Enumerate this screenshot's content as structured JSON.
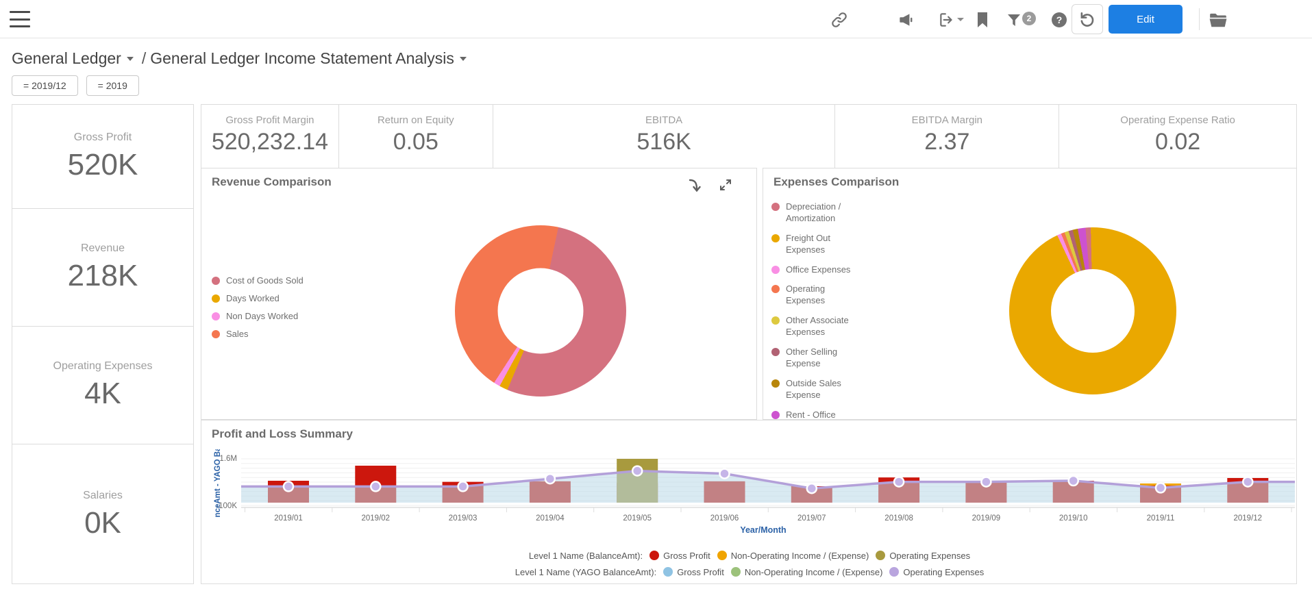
{
  "toolbar": {
    "edit_label": "Edit",
    "filter_badge": "2",
    "icons": [
      "menu-icon",
      "link-icon",
      "megaphone-icon",
      "export-icon",
      "bookmark-icon",
      "filter-icon",
      "help-icon",
      "undo-icon",
      "folder-icon"
    ]
  },
  "breadcrumb": {
    "folder": "General Ledger",
    "page": "General Ledger Income Statement Analysis",
    "separator": "/"
  },
  "filters": [
    {
      "label": "= 2019/12"
    },
    {
      "label": "= 2019"
    }
  ],
  "left_kpis": [
    {
      "label": "Gross Profit",
      "value": "520K"
    },
    {
      "label": "Revenue",
      "value": "218K"
    },
    {
      "label": "Operating Expenses",
      "value": "4K"
    },
    {
      "label": "Salaries",
      "value": "0K"
    }
  ],
  "top_kpis": [
    {
      "label": "Gross Profit Margin",
      "value": "520,232.14"
    },
    {
      "label": "Return on Equity",
      "value": "0.05"
    },
    {
      "label": "EBITDA",
      "value": "516K"
    },
    {
      "label": "EBITDA Margin",
      "value": "2.37"
    },
    {
      "label": "Operating Expense Ratio",
      "value": "0.02"
    }
  ],
  "colors": {
    "accent_blue": "#1d7fe3",
    "axis_blue": "#2c62a7",
    "panel_border": "#dcdcdc"
  },
  "chart_data": [
    {
      "type": "pie",
      "title": "Revenue Comparison",
      "donut": true,
      "start_deg": 12,
      "legend_position": "left",
      "slices": [
        {
          "name": "Cost of Goods Sold",
          "color": "#d4717f",
          "pct": 53.0
        },
        {
          "name": "Days Worked",
          "color": "#eaa800",
          "pct": 1.6
        },
        {
          "name": "Non Days Worked",
          "color": "#f98fe4",
          "pct": 1.2
        },
        {
          "name": "Sales",
          "color": "#f4764f",
          "pct": 44.2
        }
      ]
    },
    {
      "type": "pie",
      "title": "Expenses Comparison",
      "donut": true,
      "start_deg": -5,
      "legend_position": "left",
      "slices": [
        {
          "name": "Depreciation / Amortization",
          "color": "#d4717f",
          "pct": 1.0
        },
        {
          "name": "Freight Out Expenses",
          "color": "#eaa800",
          "pct": 93.4
        },
        {
          "name": "Office Expenses",
          "color": "#f98fe4",
          "pct": 0.8
        },
        {
          "name": "Operating Expenses",
          "color": "#f4764f",
          "pct": 0.7
        },
        {
          "name": "Other Associate Expenses",
          "color": "#ddc93f",
          "pct": 0.8
        },
        {
          "name": "Other Selling Expense",
          "color": "#b16273",
          "pct": 0.8
        },
        {
          "name": "Outside Sales Expense",
          "color": "#b8860b",
          "pct": 1.0
        },
        {
          "name": "Rent - Office",
          "color": "#cd52cf",
          "pct": 1.5
        }
      ]
    },
    {
      "type": "bar",
      "title": "Profit and Loss Summary",
      "xlabel": "Year/Month",
      "y_axis_label": "nceAmt - YAGO Ba",
      "y_ticks": [
        "1.6M",
        "-100K"
      ],
      "ylim": [
        -100000,
        1600000
      ],
      "grid": true,
      "categories": [
        "2019/01",
        "2019/02",
        "2019/03",
        "2019/04",
        "2019/05",
        "2019/06",
        "2019/07",
        "2019/08",
        "2019/09",
        "2019/10",
        "2019/11",
        "2019/12"
      ],
      "series": [
        {
          "name": "Gross Profit",
          "group": "Level 1 Name (BalanceAmt)",
          "render": "bar",
          "color": "#cc170d",
          "values": [
            800000,
            1350000,
            760000,
            780000,
            720000,
            780000,
            600000,
            920000,
            780000,
            800000,
            620000,
            900000
          ]
        },
        {
          "name": "Non-Operating Income / (Expense)",
          "group": "Level 1 Name (BalanceAmt)",
          "render": "bar",
          "color": "#f0a400",
          "values": [
            0,
            0,
            0,
            0,
            0,
            0,
            0,
            0,
            0,
            0,
            700000,
            0
          ]
        },
        {
          "name": "Operating Expenses",
          "group": "Level 1 Name (BalanceAmt)",
          "render": "bar",
          "color": "#a89a3e",
          "values": [
            0,
            0,
            0,
            0,
            1600000,
            0,
            0,
            0,
            0,
            0,
            0,
            0
          ]
        },
        {
          "name": "Gross Profit",
          "group": "Level 1 Name (YAGO BalanceAmt)",
          "render": "area",
          "color": "#b9d8e8",
          "values": [
            590000,
            590000,
            590000,
            870000,
            1160000,
            1060000,
            520000,
            760000,
            760000,
            800000,
            540000,
            760000
          ]
        },
        {
          "name": "Operating Expenses",
          "group": "Level 1 Name (YAGO BalanceAmt)",
          "render": "line",
          "color": "#b3a0d9",
          "values": [
            590000,
            590000,
            590000,
            870000,
            1160000,
            1060000,
            520000,
            760000,
            760000,
            800000,
            540000,
            760000
          ]
        }
      ],
      "legend_rows": [
        {
          "label": "Level 1 Name (BalanceAmt):",
          "items": [
            {
              "name": "Gross Profit",
              "color": "#cc170d"
            },
            {
              "name": "Non-Operating Income / (Expense)",
              "color": "#f0a400"
            },
            {
              "name": "Operating Expenses",
              "color": "#a89a3e"
            }
          ]
        },
        {
          "label": "Level 1 Name (YAGO BalanceAmt):",
          "items": [
            {
              "name": "Gross Profit",
              "color": "#8fc3e3"
            },
            {
              "name": "Non-Operating Income / (Expense)",
              "color": "#9cc27b"
            },
            {
              "name": "Operating Expenses",
              "color": "#b9a5de"
            }
          ]
        }
      ]
    }
  ]
}
